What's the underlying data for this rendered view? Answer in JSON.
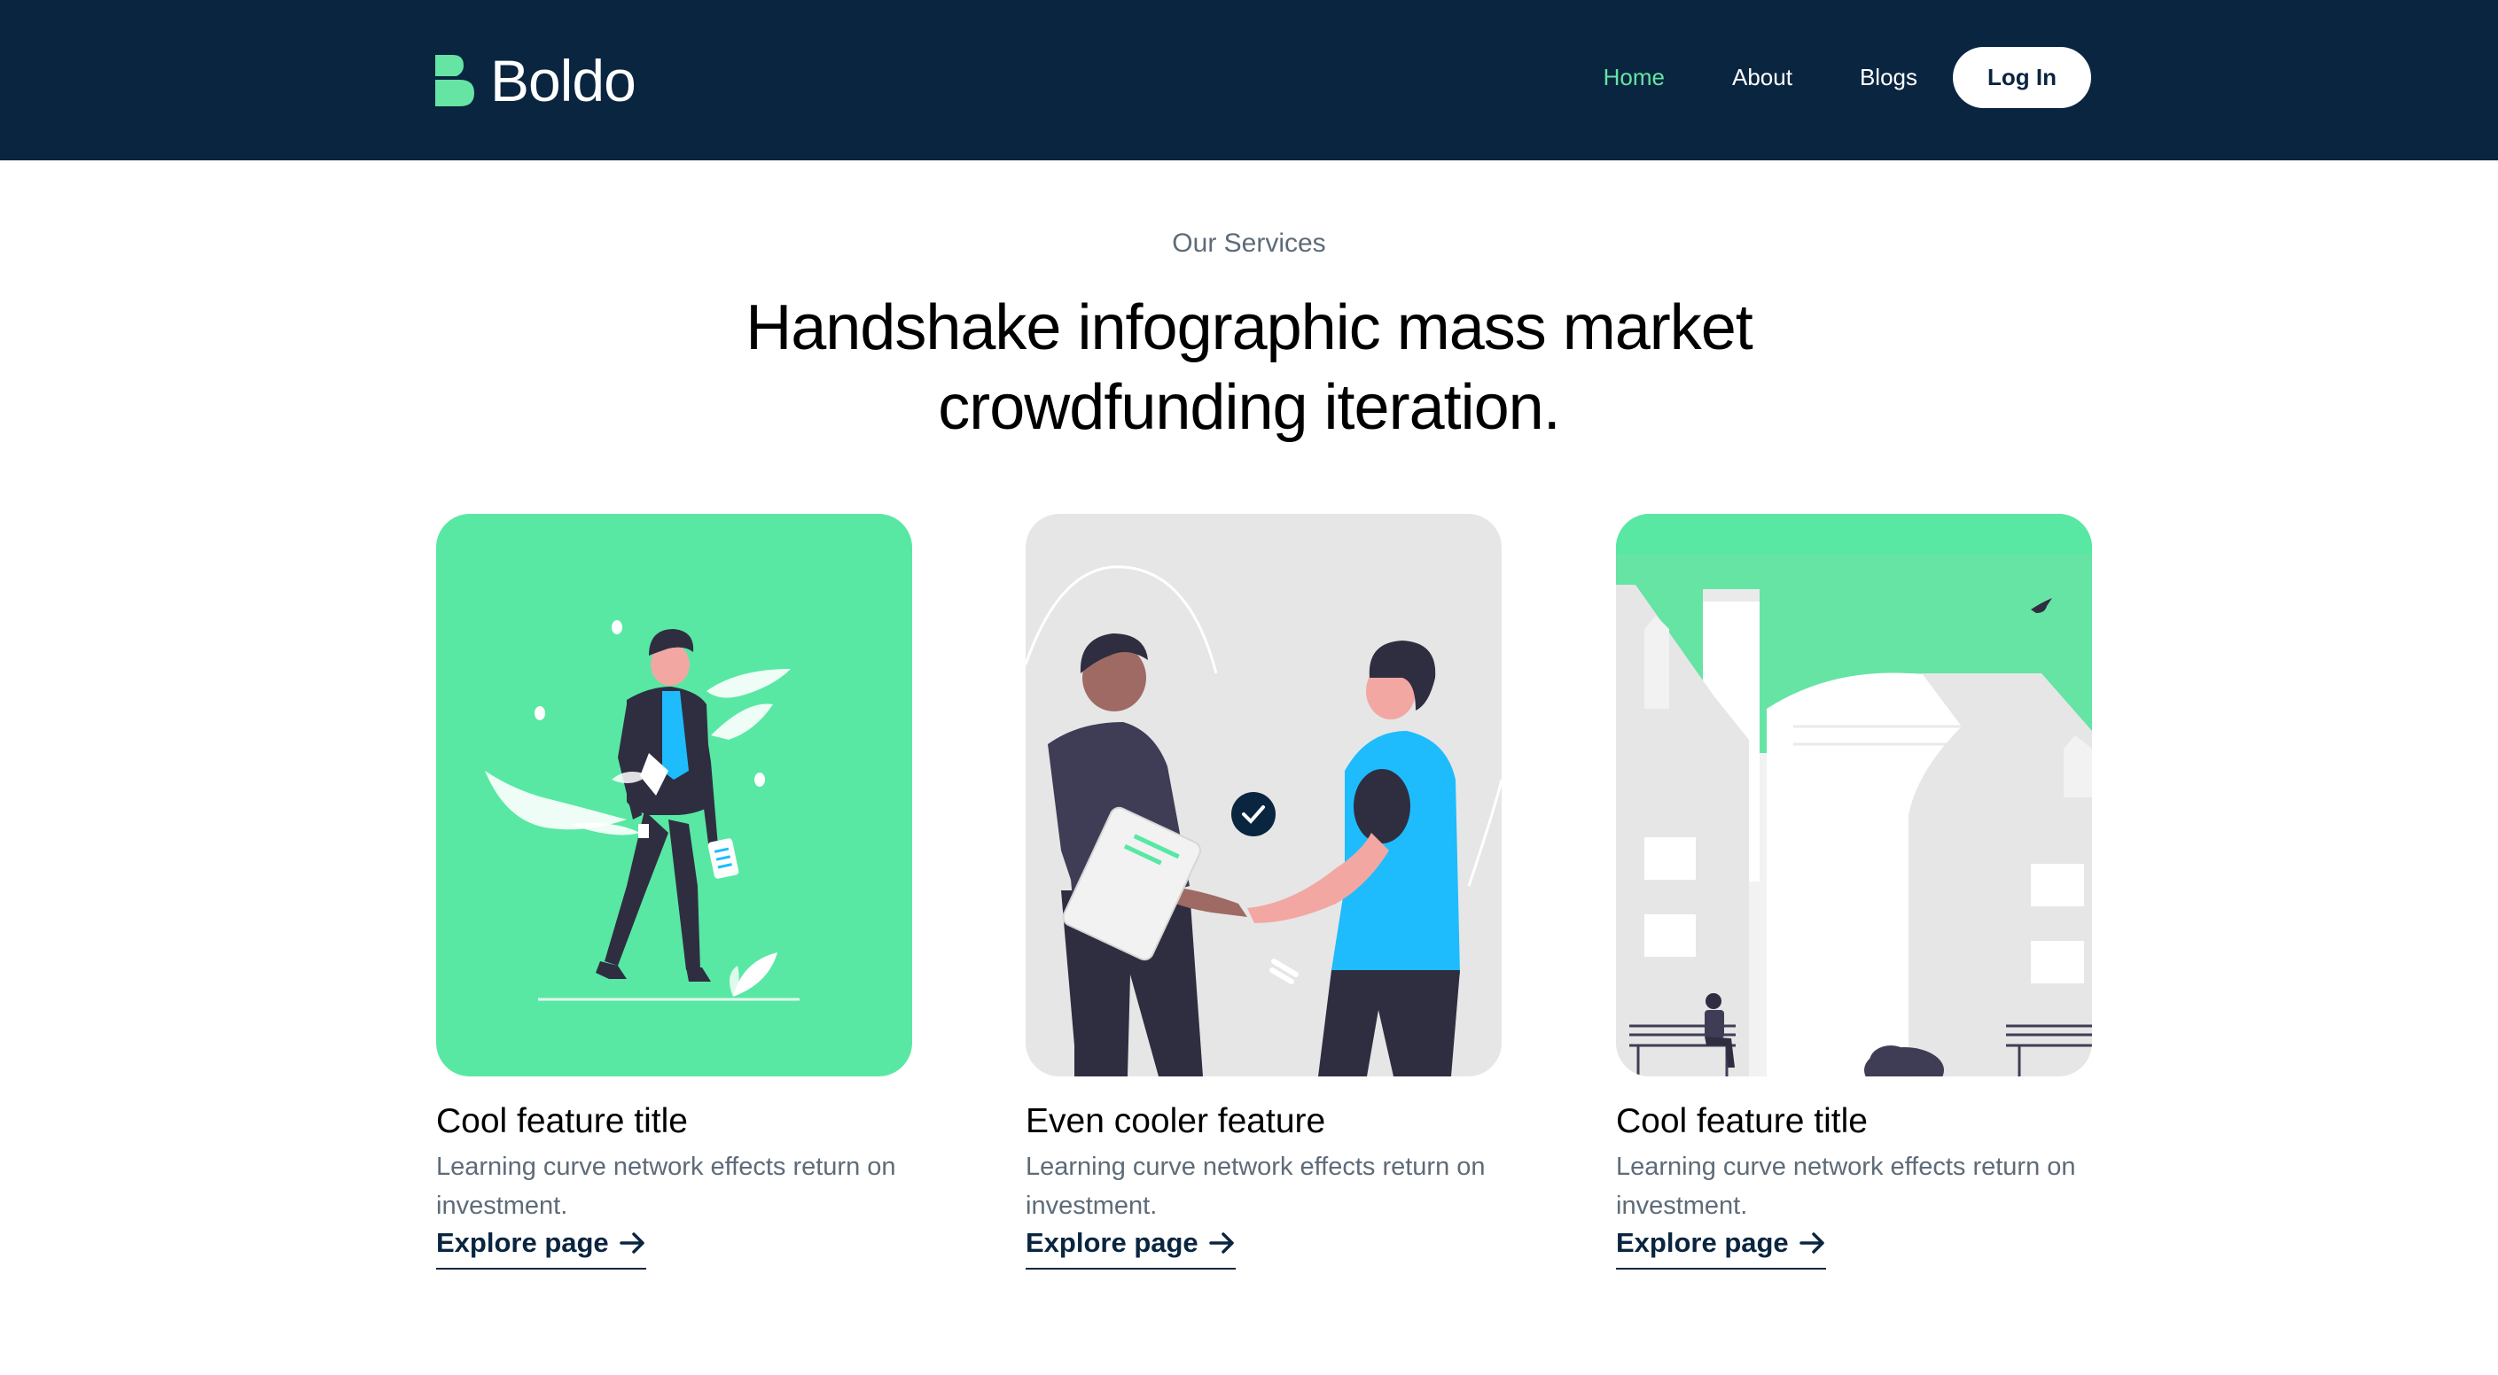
{
  "header": {
    "brand": "Boldo",
    "nav": [
      {
        "label": "Home",
        "active": true
      },
      {
        "label": "About",
        "active": false
      },
      {
        "label": "Blogs",
        "active": false
      }
    ],
    "login_label": "Log In"
  },
  "section": {
    "eyebrow": "Our Services",
    "headline_line1": "Handshake infographic mass market",
    "headline_line2": "crowdfunding iteration."
  },
  "cards": [
    {
      "title": "Cool feature title",
      "description": "Learning curve network effects return on investment.",
      "link_label": "Explore page",
      "illustration": "person-walking-with-tablet"
    },
    {
      "title": "Even cooler feature",
      "description": "Learning curve network effects return on investment.",
      "link_label": "Explore page",
      "illustration": "handshake-agreement"
    },
    {
      "title": "Cool feature title",
      "description": "Learning curve network effects return on investment.",
      "link_label": "Explore page",
      "illustration": "city-buildings-bench"
    }
  ],
  "colors": {
    "navy": "#0a2540",
    "accent_green": "#65e4a3",
    "card_green": "#58e8a4",
    "card_grey": "#e6e6e6",
    "muted_text": "#5e6b78"
  },
  "icons": {
    "logo": "boldo-b-logo-icon",
    "link_arrow": "arrow-right-icon"
  }
}
